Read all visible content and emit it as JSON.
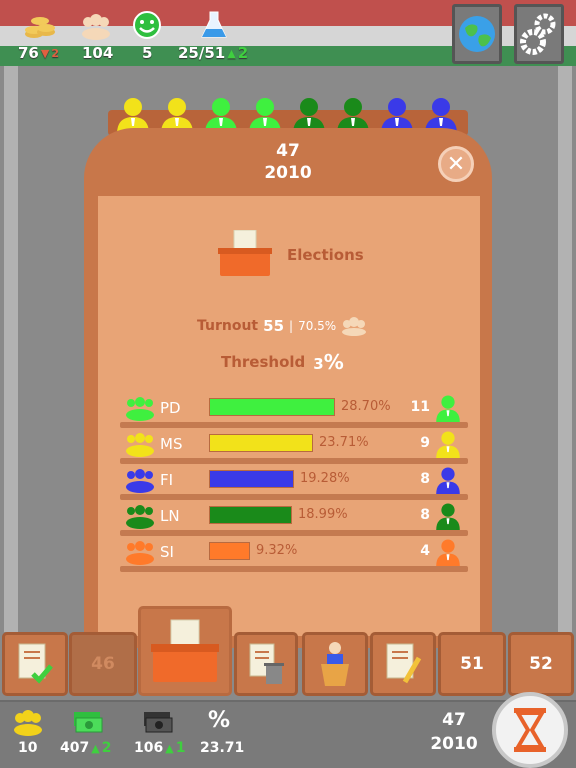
{
  "colors": {
    "pd": "#3ff03f",
    "ms": "#f2e21a",
    "fi": "#3a3ae8",
    "ln": "#1a8a1a",
    "si": "#ff7a2a",
    "panel": "#c8774a",
    "inner": "#e8a476",
    "accent_text": "#b85c36"
  },
  "top": {
    "money": "76",
    "money_delta": "2",
    "money_trend": "down",
    "population": "104",
    "happiness": "5",
    "research": "25/51",
    "research_delta": "2",
    "research_trend": "up",
    "icons": [
      "coins-icon",
      "crowd-icon",
      "smiley-icon",
      "flask-icon",
      "globe-icon",
      "settings-gears-icon"
    ]
  },
  "panel": {
    "turn": "47",
    "year": "2010",
    "title": "Elections",
    "turnout_label": "Turnout",
    "turnout_value": "55",
    "turnout_pct": "70.5%",
    "threshold_label": "Threshold",
    "threshold_value": "3",
    "threshold_unit": "%",
    "parties": [
      {
        "name": "PD",
        "pct": "28.70%",
        "share": 28.7,
        "seats": "11",
        "color": "#3ff03f"
      },
      {
        "name": "MS",
        "pct": "23.71%",
        "share": 23.71,
        "seats": "9",
        "color": "#f2e21a"
      },
      {
        "name": "FI",
        "pct": "19.28%",
        "share": 19.28,
        "seats": "8",
        "color": "#3a3ae8"
      },
      {
        "name": "LN",
        "pct": "18.99%",
        "share": 18.99,
        "seats": "8",
        "color": "#1a8a1a"
      },
      {
        "name": "SI",
        "pct": "9.32%",
        "share": 9.32,
        "seats": "4",
        "color": "#ff7a2a"
      }
    ]
  },
  "parliament": {
    "seat_colors": [
      "#f2e21a",
      "#f2e21a",
      "#3ff03f",
      "#3ff03f",
      "#1a8a1a",
      "#1a8a1a",
      "#3a3ae8",
      "#3a3ae8"
    ]
  },
  "tabs": {
    "t46": "46",
    "t51": "51",
    "t52": "52"
  },
  "bottom": {
    "population": "10",
    "cash": "407",
    "cash_delta": "2",
    "debt": "106",
    "debt_delta": "1",
    "percent_value": "23.71",
    "percent_symbol": "%",
    "turn": "47",
    "year": "2010"
  }
}
